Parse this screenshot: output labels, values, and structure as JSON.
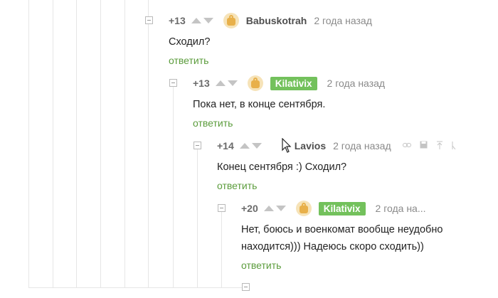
{
  "comments": [
    {
      "rating": "+13",
      "author": "Babuskotrah",
      "time": "2 года назад",
      "text": "Сходил?",
      "reply": "ответить"
    },
    {
      "rating": "+13",
      "author": "Kilativix",
      "time": "2 года назад",
      "text": "Пока нет, в конце сентября.",
      "reply": "ответить"
    },
    {
      "rating": "+14",
      "author": "Lavios",
      "time": "2 года назад",
      "text": "Конец сентября :) Сходил?",
      "reply": "ответить",
      "tools": [
        "link-icon",
        "save-icon",
        "scroll-up-icon",
        "more-icon"
      ]
    },
    {
      "rating": "+20",
      "author": "Kilativix",
      "time": "2 года на...",
      "text_line1": "Нет, боюсь и военкомат вообще неудобно",
      "text_line2": "находится))) Надеюсь скоро сходить))",
      "reply": "ответить"
    }
  ],
  "colors": {
    "reply_link": "#5b9c3c",
    "author_badge": "#73c15c",
    "thread_line": "#e6e6e6"
  }
}
